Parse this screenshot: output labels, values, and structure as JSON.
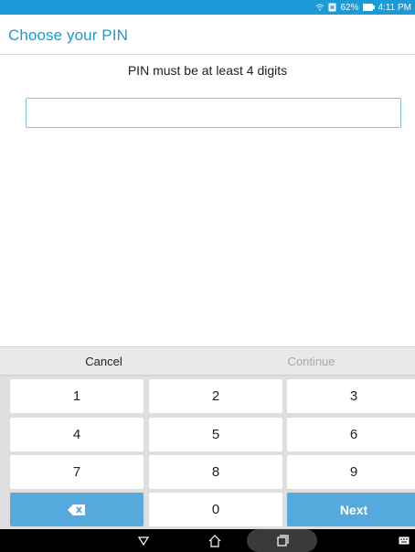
{
  "status_bar": {
    "battery": "62%",
    "time": "4:11 PM"
  },
  "app_bar": {
    "title": "Choose your PIN"
  },
  "content": {
    "hint": "PIN must be at least 4 digits",
    "pin_value": ""
  },
  "actions": {
    "cancel": "Cancel",
    "continue": "Continue"
  },
  "keypad": {
    "keys": [
      "1",
      "2",
      "3",
      "4",
      "5",
      "6",
      "7",
      "8",
      "9",
      "",
      "0",
      "Next"
    ],
    "accent": "#55a9dd"
  },
  "icons": {
    "wifi": "wifi-icon",
    "sim": "sim-icon",
    "battery": "battery-icon",
    "backspace": "backspace-icon",
    "back": "back-icon",
    "home": "home-icon",
    "recents": "recents-icon",
    "keyboard": "keyboard-icon"
  },
  "colors": {
    "primary": "#1a9ad6",
    "keypad_bg": "#dedede",
    "nav": "#000000"
  }
}
